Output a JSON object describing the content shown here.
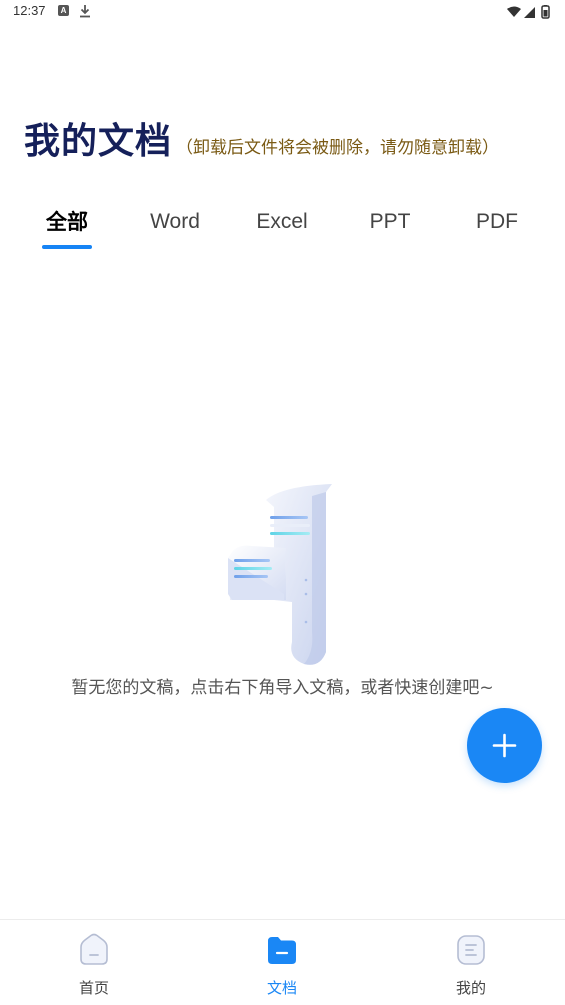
{
  "status_bar": {
    "time": "12:37"
  },
  "header": {
    "title": "我的文档",
    "subtitle": "（卸载后文件将会被删除，请勿随意卸载）"
  },
  "tabs": [
    {
      "label": "全部",
      "active": true
    },
    {
      "label": "Word",
      "active": false
    },
    {
      "label": "Excel",
      "active": false
    },
    {
      "label": "PPT",
      "active": false
    },
    {
      "label": "PDF",
      "active": false
    }
  ],
  "empty_state": {
    "message": "暂无您的文稿，点击右下角导入文稿，或者快速创建吧~"
  },
  "fab": {
    "icon": "plus-icon"
  },
  "bottom_nav": [
    {
      "label": "首页",
      "icon": "home-icon",
      "active": false
    },
    {
      "label": "文档",
      "icon": "folder-icon",
      "active": true
    },
    {
      "label": "我的",
      "icon": "profile-icon",
      "active": false
    }
  ],
  "colors": {
    "accent": "#1a87f5",
    "title": "#15205a",
    "subtitle": "#7a5a14"
  }
}
